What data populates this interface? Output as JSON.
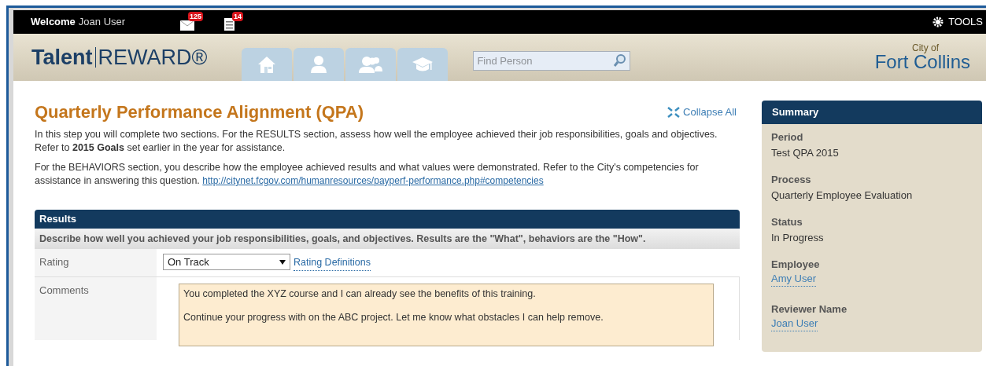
{
  "top_bar": {
    "welcome": "Welcome",
    "user": "Joan User",
    "badges": [
      {
        "kind": "mail",
        "count": "125"
      },
      {
        "kind": "tasks",
        "count": "14"
      }
    ],
    "tools": "TOOLS"
  },
  "header": {
    "brand_bold": "Talent",
    "brand_light": "REWARD®",
    "nav": [
      {
        "kind": "home"
      },
      {
        "kind": "person"
      },
      {
        "kind": "group"
      },
      {
        "kind": "learning"
      }
    ],
    "search": {
      "placeholder": "Find Person"
    },
    "logo_small": "City of",
    "logo_big": "Fort Collins"
  },
  "page": {
    "title": "Quarterly Performance Alignment (QPA)",
    "collapse": "Collapse All",
    "paragraphs": [
      {
        "text": "In this step you will complete two sections. For the RESULTS section, assess how well the employee achieved their job responsibilities, goals and objectives.  Refer to **2015 Goals** set earlier in the year for assistance."
      },
      {
        "text": "For the BEHAVIORS section, you describe how the employee achieved results and what values were demonstrated.  Refer to the City's competencies for assistance in answering this question.",
        "link": "http://citynet.fcgov.com/humanresources/payperf-performance.php#competencies"
      }
    ]
  },
  "results": {
    "title": "Results",
    "description": "Describe how well you achieved your job responsibilities, goals, and objectives. Results are the \"What\", behaviors are the \"How\".",
    "rating": {
      "label": "Rating",
      "value": "On Track",
      "link": "Rating Definitions"
    },
    "comments": {
      "label": "Comments",
      "lines": [
        "You completed the XYZ course and I can already see the benefits of this training.",
        "Continue your progress with on the ABC project.  Let me know what obstacles I can help remove."
      ]
    }
  },
  "summary": {
    "title": "Summary",
    "fields": [
      {
        "label": "Period",
        "value": "Test QPA 2015",
        "kind": "text"
      },
      {
        "label": "Process",
        "value": "Quarterly Employee Evaluation",
        "kind": "text"
      },
      {
        "label": "Status",
        "value": "In Progress",
        "kind": "text"
      },
      {
        "label": "Employee",
        "value": "Amy User",
        "kind": "link"
      },
      {
        "label": "Reviewer Name",
        "value": "Joan User",
        "kind": "link"
      }
    ]
  }
}
